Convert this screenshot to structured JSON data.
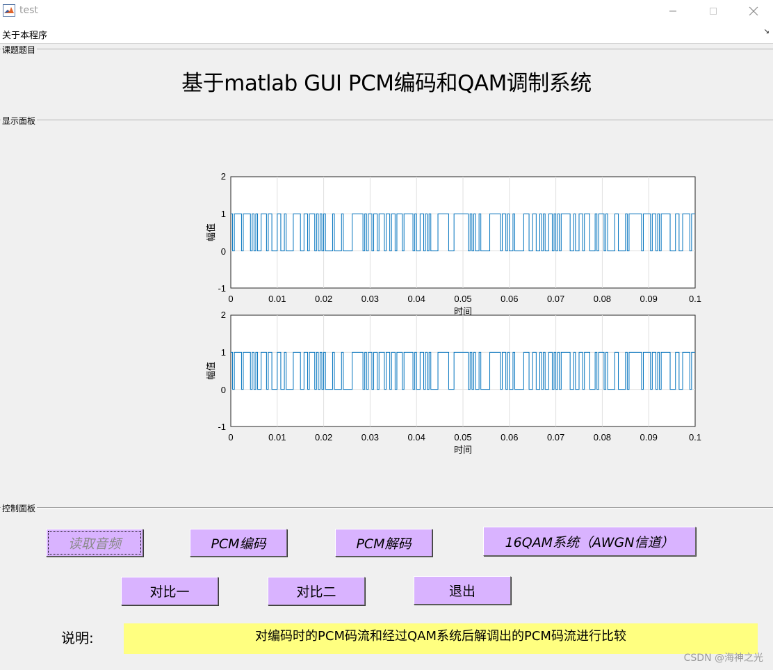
{
  "window": {
    "title": "test"
  },
  "menu": {
    "item_label": "关于本程序",
    "arrow": "↘"
  },
  "panels": {
    "title_panel": "课题题目",
    "display_panel": "显示面板",
    "control_panel": "控制面板"
  },
  "main_title": "基于matlab GUI PCM编码和QAM调制系统",
  "plots": [
    {
      "ylabel": "幅值",
      "xlabel": "时间",
      "yticks": [
        "2",
        "1",
        "0",
        "-1"
      ],
      "xticks": [
        "0",
        "0.01",
        "0.02",
        "0.03",
        "0.04",
        "0.05",
        "0.06",
        "0.07",
        "0.08",
        "0.09",
        "0.1"
      ]
    },
    {
      "ylabel": "幅值",
      "xlabel": "时间",
      "yticks": [
        "2",
        "1",
        "0",
        "-1"
      ],
      "xticks": [
        "0",
        "0.01",
        "0.02",
        "0.03",
        "0.04",
        "0.05",
        "0.06",
        "0.07",
        "0.08",
        "0.09",
        "0.1"
      ]
    }
  ],
  "chart_data": [
    {
      "type": "line",
      "xlabel": "时间",
      "ylabel": "幅值",
      "xlim": [
        0,
        0.1
      ],
      "ylim": [
        -1,
        2
      ],
      "grid": true,
      "series_color": "#0072bd",
      "description_values": "binary PCM bit stream alternating between 0 and 1"
    },
    {
      "type": "line",
      "xlabel": "时间",
      "ylabel": "幅值",
      "xlim": [
        0,
        0.1
      ],
      "ylim": [
        -1,
        2
      ],
      "grid": true,
      "series_color": "#0072bd",
      "description_values": "binary PCM bit stream alternating between 0 and 1"
    }
  ],
  "buttons": {
    "read_audio": "读取音频",
    "pcm_encode": "PCM编码",
    "pcm_decode": "PCM解码",
    "qam_system": "16QAM系统（AWGN信道）",
    "compare_one": "对比一",
    "compare_two": "对比二",
    "exit": "退出"
  },
  "explain": {
    "label": "说明:",
    "text": "对编码时的PCM码流和经过QAM系统后解调出的PCM码流进行比较"
  },
  "watermark": "CSDN @海神之光",
  "colors": {
    "button_bg": "#d9b3ff",
    "explain_bg": "#ffff80",
    "plot_line": "#0072bd"
  }
}
